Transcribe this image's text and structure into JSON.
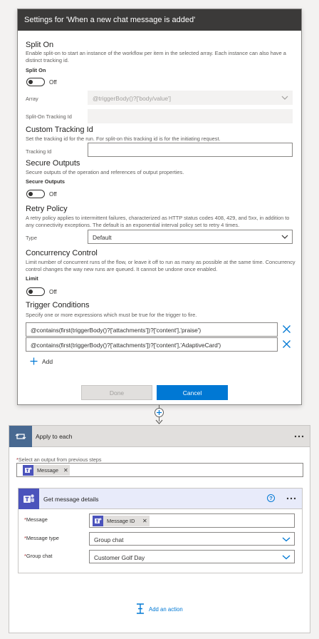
{
  "panel": {
    "title": "Settings for 'When a new chat message is added'",
    "split_on": {
      "title": "Split On",
      "description": "Enable split-on to start an instance of the workflow per item in the selected array. Each instance can also have a distinct tracking id.",
      "bold_label": "Split On",
      "toggle_state": "Off",
      "array_label": "Array",
      "array_value": "@triggerBody()?['body/value']",
      "tracking_label": "Split-On Tracking Id",
      "tracking_value": ""
    },
    "custom_tracking": {
      "title": "Custom Tracking Id",
      "description": "Set the tracking id for the run. For split-on this tracking id is for the initiating request.",
      "field_label": "Tracking Id",
      "field_value": ""
    },
    "secure_outputs": {
      "title": "Secure Outputs",
      "description": "Secure outputs of the operation and references of output properties.",
      "bold_label": "Secure Outputs",
      "toggle_state": "Off"
    },
    "retry_policy": {
      "title": "Retry Policy",
      "description": "A retry policy applies to intermittent failures, characterized as HTTP status codes 408, 429, and 5xx, in addition to any connectivity exceptions. The default is an exponential interval policy set to retry 4 times.",
      "type_label": "Type",
      "type_value": "Default"
    },
    "concurrency": {
      "title": "Concurrency Control",
      "description": "Limit number of concurrent runs of the flow, or leave it off to run as many as possible at the same time. Concurrency control changes the way new runs are queued. It cannot be undone once enabled.",
      "bold_label": "Limit",
      "toggle_state": "Off"
    },
    "trigger_conditions": {
      "title": "Trigger Conditions",
      "description": "Specify one or more expressions which must be true for the trigger to fire.",
      "conditions": [
        "@contains(first(triggerBody()?['attachments'])?['content'],'praise')",
        "@contains(first(triggerBody()?['attachments'])?['content'],'AdaptiveCard')"
      ],
      "add_label": "Add"
    },
    "done_label": "Done",
    "cancel_label": "Cancel"
  },
  "apply_to_each": {
    "title": "Apply to each",
    "select_label": "Select an output from previous steps",
    "token": "Message",
    "action": {
      "title": "Get message details",
      "fields": [
        {
          "label": "Message",
          "value": "Message ID",
          "kind": "token"
        },
        {
          "label": "Message type",
          "value": "Group chat",
          "kind": "dropdown"
        },
        {
          "label": "Group chat",
          "value": "Customer Golf Day",
          "kind": "dropdown"
        }
      ]
    },
    "add_action_label": "Add an action"
  },
  "colors": {
    "accent": "#0078d4",
    "panel_header": "#3b3a39",
    "loop_icon": "#486991",
    "teams": "#4b53bc"
  },
  "icons": [
    "chevron-down-icon",
    "close-icon",
    "plus-icon",
    "loop-icon",
    "teams-icon",
    "help-icon",
    "more-icon",
    "add-action-icon"
  ]
}
